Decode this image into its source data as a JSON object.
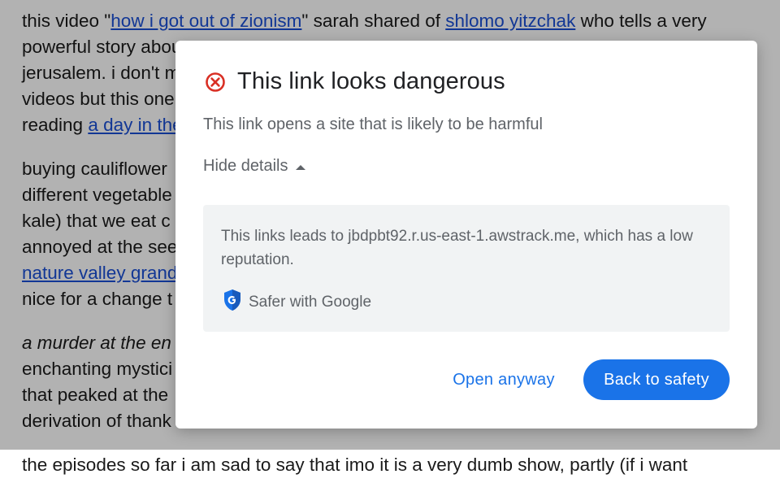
{
  "background": {
    "lines": [
      [
        {
          "t": "this video \""
        },
        {
          "t": "how i got out of zionism",
          "link": true
        },
        {
          "t": "\" sarah shared of "
        },
        {
          "t": "shlomo yitzchak",
          "link": true
        },
        {
          "t": " who tells a very"
        }
      ],
      [
        {
          "t": "powerful story about"
        }
      ],
      [
        {
          "t": "jerusalem. i don't m"
        }
      ],
      [
        {
          "t": "videos but this one"
        }
      ],
      [
        {
          "t": "reading "
        },
        {
          "t": "a day in the",
          "link": true
        }
      ],
      [
        {
          "t": "buying cauliflower"
        }
      ],
      [
        {
          "t": "different vegetable"
        }
      ],
      [
        {
          "t": "kale) that we eat c"
        }
      ],
      [
        {
          "t": "annoyed at the see"
        }
      ],
      [
        {
          "t": "nature valley grand",
          "link": true
        }
      ],
      [
        {
          "t": "nice for a change t"
        }
      ],
      [
        {
          "t": "a murder at the en",
          "italic": true
        }
      ],
      [
        {
          "t": "enchanting mystici"
        }
      ],
      [
        {
          "t": "that peaked at the"
        }
      ],
      [
        {
          "t": "derivation of thank"
        }
      ],
      [
        {
          "t": "the episodes so far i am sad to say that imo it is a very dumb show, partly (if i want"
        }
      ]
    ]
  },
  "dialog": {
    "title": "This link looks dangerous",
    "subtitle": "This link opens a site that is likely to be harmful",
    "toggle_label": "Hide details",
    "details_text": "This links leads to jbdpbt92.r.us-east-1.awstrack.me, which has a low reputation.",
    "brand_label": "Safer with Google",
    "open_anyway_label": "Open anyway",
    "back_to_safety_label": "Back to safety",
    "icons": {
      "warning": "error-circle-icon",
      "toggle": "caret-up-icon",
      "brand": "google-shield-icon"
    },
    "colors": {
      "danger": "#d93025",
      "primary": "#1a73e8",
      "details_bg": "#f1f3f4",
      "text_secondary": "#5f6368"
    }
  }
}
